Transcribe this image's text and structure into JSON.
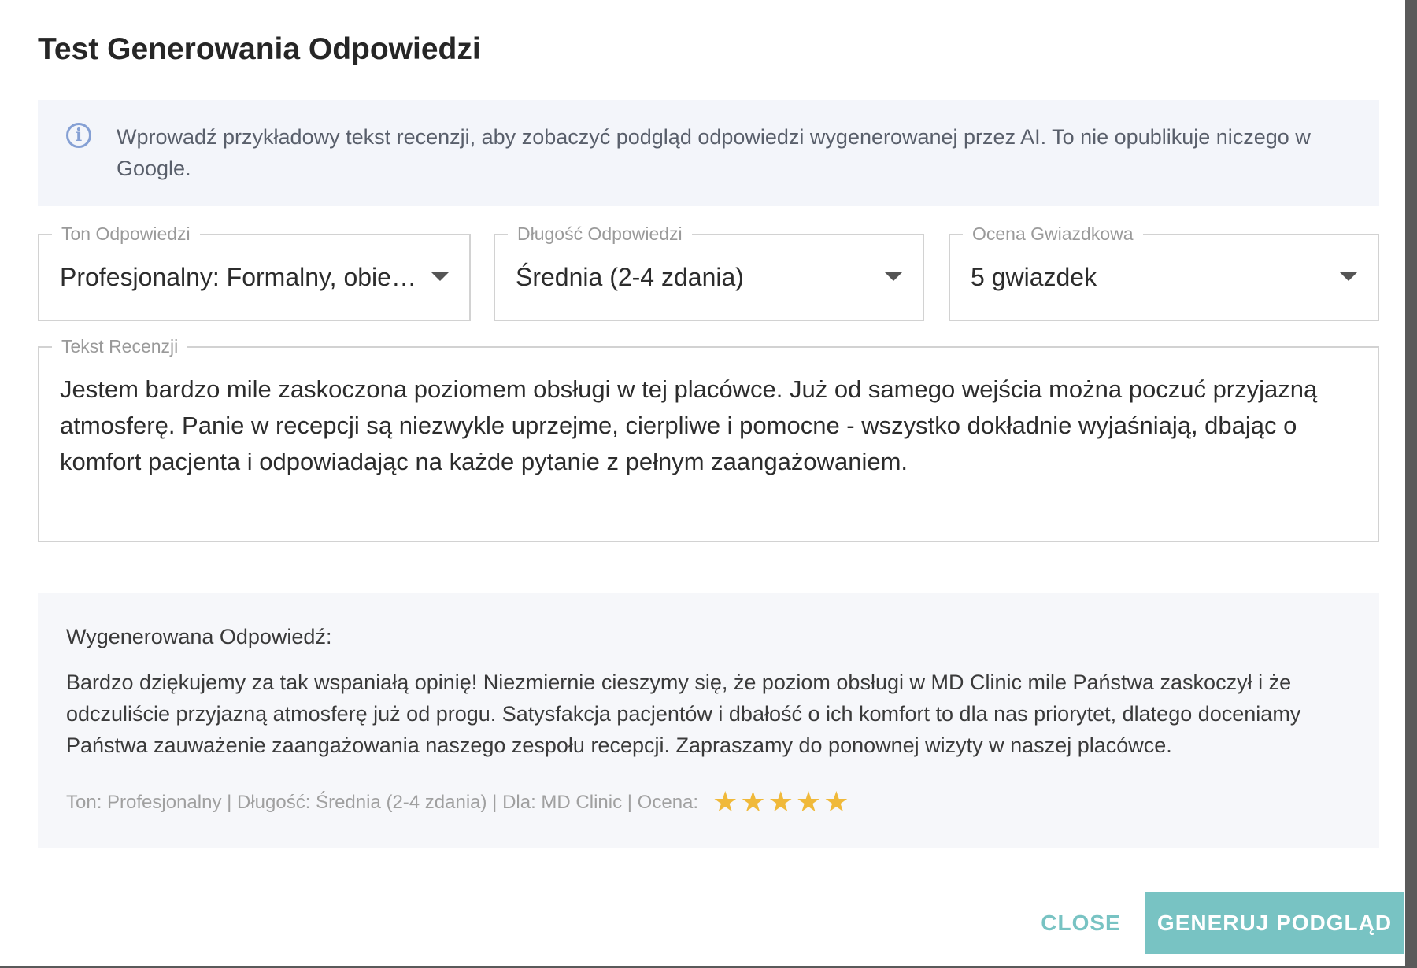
{
  "dialog": {
    "title": "Test Generowania Odpowiedzi"
  },
  "info": {
    "icon": "info-icon",
    "text": "Wprowadź przykładowy tekst recenzji, aby zobaczyć podgląd odpowiedzi wygenerowanej przez AI. To nie opublikuje niczego w Google."
  },
  "fields": {
    "tone": {
      "label": "Ton Odpowiedzi",
      "value": "Profesjonalny: Formalny, obiektywny"
    },
    "length": {
      "label": "Długość Odpowiedzi",
      "value": "Średnia (2-4 zdania)"
    },
    "rating": {
      "label": "Ocena Gwiazdkowa",
      "value": "5 gwiazdek"
    },
    "review": {
      "label": "Tekst Recenzji",
      "value": "Jestem bardzo mile zaskoczona poziomem obsługi w tej placówce. Już od samego wejścia można poczuć przyjazną atmosferę. Panie w recepcji są niezwykle uprzejme, cierpliwe i pomocne - wszystko dokładnie wyjaśniają, dbając o komfort pacjenta i odpowiadając na każde pytanie z pełnym zaangażowaniem."
    }
  },
  "generated": {
    "heading": "Wygenerowana Odpowiedź:",
    "body": "Bardzo dziękujemy za tak wspaniałą opinię! Niezmiernie cieszymy się, że poziom obsługi w MD Clinic mile Państwa zaskoczył i że odczuliście przyjazną atmosferę już od progu. Satysfakcja pacjentów i dbałość o ich komfort to dla nas priorytet, dlatego doceniamy Państwa zauważenie zaangażowania naszego zespołu recepcji. Zapraszamy do ponownej wizyty w naszej placówce.",
    "meta": "Ton: Profesjonalny | Długość: Średnia (2-4 zdania) | Dla: MD Clinic | Ocena:",
    "stars": 5,
    "star_icon": "star-icon",
    "star_color": "#f0b93a"
  },
  "actions": {
    "close_label": "CLOSE",
    "generate_label": "GENERUJ PODGLĄD"
  },
  "colors": {
    "accent": "#78c3c3",
    "info_icon": "#85a0d4",
    "info_bg": "#f3f5fa"
  }
}
